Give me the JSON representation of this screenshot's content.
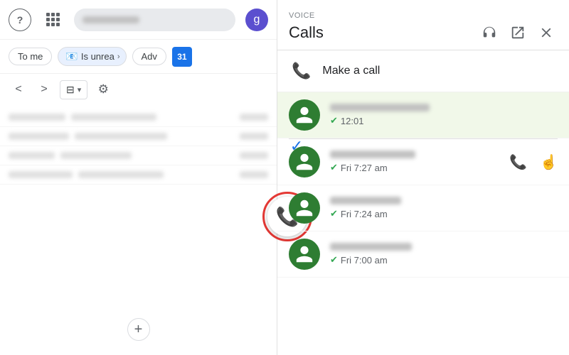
{
  "left": {
    "help_icon": "?",
    "grid_icon": "grid",
    "avatar_label": "g",
    "filters": {
      "to_me": "To me",
      "is_unread": "Is unrea",
      "advance": "Adv"
    },
    "calendar_day": "31",
    "nav": {
      "prev": "<",
      "next": ">"
    },
    "gear": "⚙",
    "plus": "+",
    "emails": [
      {
        "sender_width": 70,
        "subject_width": 110
      },
      {
        "sender_width": 85,
        "subject_width": 130
      },
      {
        "sender_width": 65,
        "subject_width": 100
      },
      {
        "sender_width": 90,
        "subject_width": 120
      }
    ]
  },
  "voice_panel": {
    "label": "VOICE",
    "title": "Calls",
    "make_call": "Make a call",
    "calls": [
      {
        "time": "12:01",
        "highlighted": true
      },
      {
        "time": "Fri 7:27 am",
        "highlighted": false
      },
      {
        "time": "Fri 7:24 am",
        "highlighted": false
      },
      {
        "time": "Fri 7:00 am",
        "highlighted": false
      }
    ]
  }
}
